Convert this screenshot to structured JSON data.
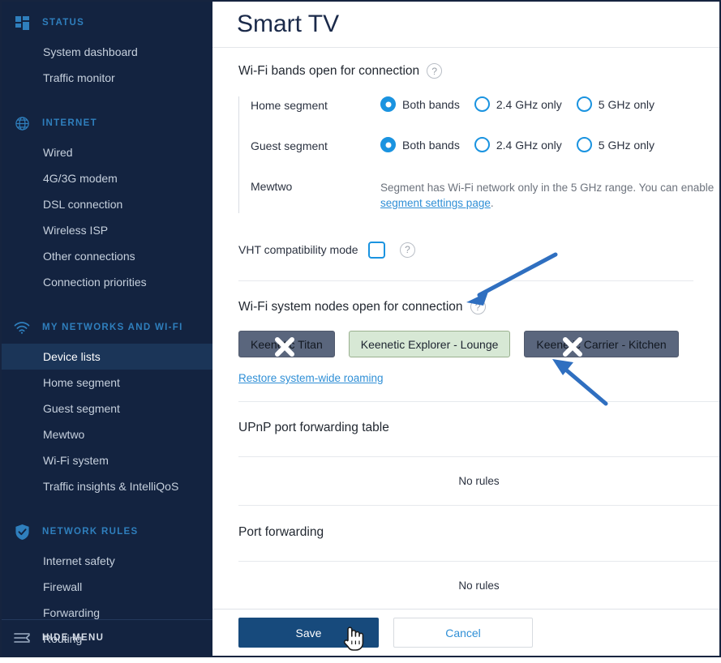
{
  "sidebar": {
    "groups": [
      {
        "title": "STATUS",
        "icon": "dashboard-grid-icon",
        "items": [
          {
            "label": "System dashboard",
            "active": false
          },
          {
            "label": "Traffic monitor",
            "active": false
          }
        ]
      },
      {
        "title": "INTERNET",
        "icon": "globe-icon",
        "items": [
          {
            "label": "Wired",
            "active": false
          },
          {
            "label": "4G/3G modem",
            "active": false
          },
          {
            "label": "DSL connection",
            "active": false
          },
          {
            "label": "Wireless ISP",
            "active": false
          },
          {
            "label": "Other connections",
            "active": false
          },
          {
            "label": "Connection priorities",
            "active": false
          }
        ]
      },
      {
        "title": "MY NETWORKS AND WI-FI",
        "icon": "wifi-icon",
        "items": [
          {
            "label": "Device lists",
            "active": true
          },
          {
            "label": "Home segment",
            "active": false
          },
          {
            "label": "Guest segment",
            "active": false
          },
          {
            "label": "Mewtwo",
            "active": false
          },
          {
            "label": "Wi-Fi system",
            "active": false
          },
          {
            "label": "Traffic insights & IntelliQoS",
            "active": false
          }
        ]
      },
      {
        "title": "NETWORK RULES",
        "icon": "shield-check-icon",
        "items": [
          {
            "label": "Internet safety",
            "active": false
          },
          {
            "label": "Firewall",
            "active": false
          },
          {
            "label": "Forwarding",
            "active": false
          },
          {
            "label": "Routing",
            "active": false
          }
        ]
      }
    ],
    "hide_menu_label": "HIDE MENU"
  },
  "header": {
    "title": "Smart TV"
  },
  "bands": {
    "section_title": "Wi-Fi bands open for connection",
    "help": "?",
    "options": [
      "Both bands",
      "2.4 GHz only",
      "5 GHz only"
    ],
    "rows": [
      {
        "label": "Home segment",
        "selected": 0,
        "type": "radio"
      },
      {
        "label": "Guest segment",
        "selected": 0,
        "type": "radio"
      },
      {
        "label": "Mewtwo",
        "type": "note",
        "note_text_1": "Segment has Wi-Fi network only in the 5 GHz range. You can enable ",
        "note_link": "segment settings page",
        "note_text_2": "."
      }
    ]
  },
  "vht": {
    "label": "VHT compatibility mode",
    "checked": false,
    "help": "?"
  },
  "nodes": {
    "section_title": "Wi-Fi system nodes open for connection",
    "help": "?",
    "chips": [
      {
        "label": "Keenetic Titan",
        "state": "off"
      },
      {
        "label": "Keenetic Explorer - Lounge",
        "state": "on"
      },
      {
        "label": "Keenetic Carrier - Kitchen",
        "state": "off"
      }
    ],
    "restore_link": "Restore system-wide roaming"
  },
  "upnp": {
    "title": "UPnP port forwarding table",
    "empty_text": "No rules"
  },
  "portfwd": {
    "title": "Port forwarding",
    "empty_text": "No rules"
  },
  "footer": {
    "save_label": "Save",
    "cancel_label": "Cancel"
  },
  "colors": {
    "sidebar_bg": "#132340",
    "sidebar_active": "#1b3558",
    "accent_blue": "#2f8fd6",
    "radio_blue": "#1a93e0",
    "primary_btn": "#174a7c",
    "chip_off": "#5a667d",
    "chip_on": "#d7e8d5",
    "annotation_arrow": "#2f6fc0"
  }
}
